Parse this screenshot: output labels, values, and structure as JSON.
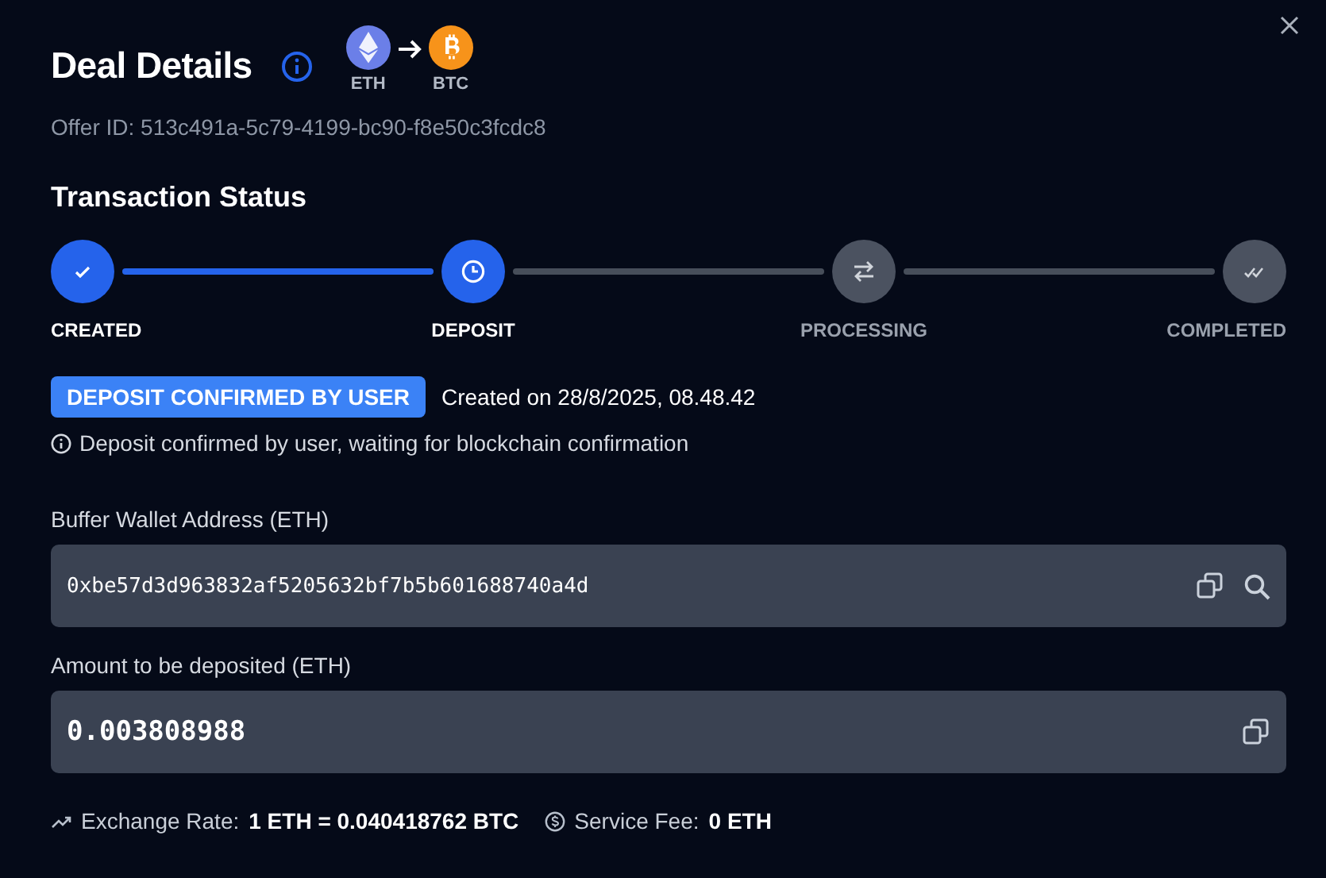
{
  "dialog": {
    "title": "Deal Details",
    "pair": {
      "from": "ETH",
      "to": "BTC"
    },
    "offer_id": "Offer ID: 513c491a-5c79-4199-bc90-f8e50c3fcdc8"
  },
  "status": {
    "heading": "Transaction Status",
    "steps": [
      {
        "label": "CREATED",
        "kind": "check",
        "reached": true
      },
      {
        "label": "DEPOSIT",
        "kind": "clock",
        "reached": true
      },
      {
        "label": "PROCESSING",
        "kind": "swap",
        "reached": false
      },
      {
        "label": "COMPLETED",
        "kind": "double-check",
        "reached": false
      }
    ],
    "badge": "DEPOSIT CONFIRMED BY USER",
    "created": "Created on 28/8/2025, 08.48.42",
    "note": "Deposit confirmed by user, waiting for blockchain confirmation"
  },
  "fields": [
    {
      "label": "Buffer Wallet Address (ETH)",
      "value": "0xbe57d3d963832af5205632bf7b5b601688740a4d",
      "kind": "address"
    },
    {
      "label": "Amount to be deposited (ETH)",
      "value": "0.003808988",
      "kind": "amount"
    }
  ],
  "footer": [
    {
      "label": "Exchange Rate:",
      "value": "1 ETH = 0.040418762 BTC",
      "kind": "rate"
    },
    {
      "label": "Service Fee:",
      "value": "0 ETH",
      "kind": "fee"
    }
  ]
}
